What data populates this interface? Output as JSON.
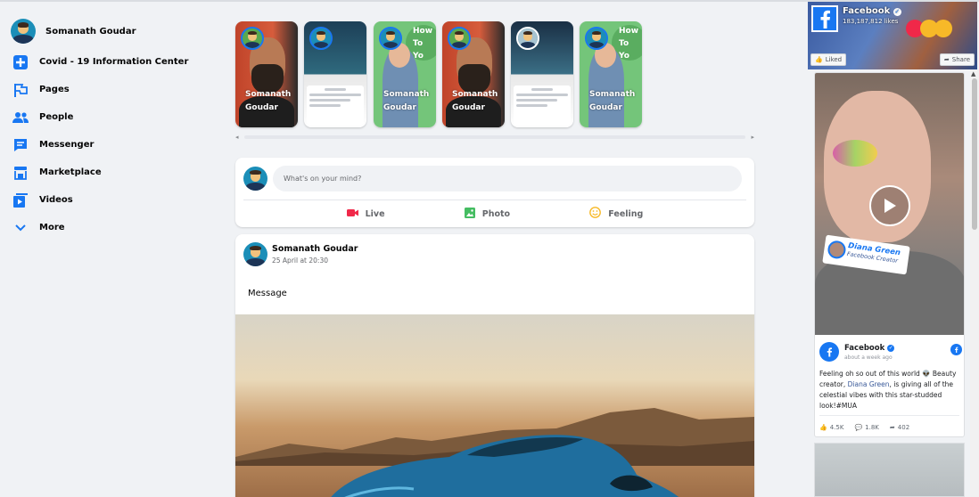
{
  "user": {
    "name": "Somanath Goudar"
  },
  "sidebar": {
    "items": [
      {
        "label": "Covid - 19 Information Center",
        "icon": "plus-square-icon"
      },
      {
        "label": "Pages",
        "icon": "flag-icon"
      },
      {
        "label": "People",
        "icon": "people-icon"
      },
      {
        "label": "Messenger",
        "icon": "messenger-icon"
      },
      {
        "label": "Marketplace",
        "icon": "store-icon"
      },
      {
        "label": "Videos",
        "icon": "video-icon"
      },
      {
        "label": "More",
        "icon": "chevron-down-icon"
      }
    ]
  },
  "stories": [
    {
      "name": "Somanath Goudar",
      "type": "photo-man"
    },
    {
      "name": "",
      "type": "phone"
    },
    {
      "name": "Somanath Goudar",
      "type": "green",
      "overlay": "How To Yo"
    },
    {
      "name": "Somanath Goudar",
      "type": "photo-man"
    },
    {
      "name": "",
      "type": "phone-dark"
    },
    {
      "name": "Somanath Goudar",
      "type": "green",
      "overlay": "How To Yo"
    }
  ],
  "composer": {
    "placeholder": "What's on your mind?",
    "actions": [
      {
        "label": "Live",
        "icon": "live-video-icon",
        "color": "#f02849"
      },
      {
        "label": "Photo",
        "icon": "photo-icon",
        "color": "#45bd62"
      },
      {
        "label": "Feeling",
        "icon": "smile-icon",
        "color": "#f7b928"
      }
    ]
  },
  "post": {
    "author": "Somanath Goudar",
    "time": "25 April at 20:30",
    "message": "Message"
  },
  "page_plugin": {
    "title": "Facebook",
    "likes": "183,187,812 likes",
    "like_label": "Liked",
    "share_label": "Share"
  },
  "embed": {
    "tag_name": "Diana Green",
    "tag_sub": "Facebook Creator",
    "page": "Facebook",
    "time": "about a week ago",
    "text_before": "Feeling oh so out of this world 👽 Beauty creator, ",
    "text_link": "Diana Green",
    "text_after": ", is giving all of the celestial vibes with this star-studded look!#MUA",
    "likes": "4.5K",
    "comments": "1.8K",
    "shares": "402"
  },
  "colors": {
    "brand": "#1877f2",
    "bg": "#f0f2f5"
  }
}
